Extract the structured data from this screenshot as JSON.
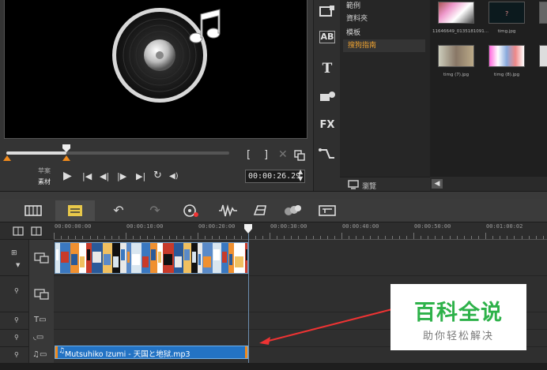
{
  "preview": {
    "scrub_progress": 0.27,
    "labels": {
      "project": "苹案",
      "clip": "素材"
    },
    "controls": {
      "play": "▶",
      "home": "|◀",
      "prev_frame": "◀|",
      "next_frame": "|▶",
      "end": "▶|",
      "repeat": "↻",
      "volume": "◀)"
    },
    "bracket_in": "[",
    "bracket_out": "]",
    "timecode": "00:00:26.29"
  },
  "tools": {
    "fx": "FX",
    "title": "T",
    "ab": "AB"
  },
  "library": {
    "items": [
      "範例",
      "資料夾",
      "模板",
      "搜狗指南"
    ],
    "active_index": 3,
    "footer_label": "瀏覽"
  },
  "thumbnails": [
    {
      "caption": "11646649_0135181091..."
    },
    {
      "caption": "timg.jpg"
    },
    {
      "caption": "timg (7).jpg"
    },
    {
      "caption": "timg (8).jpg"
    }
  ],
  "ruler": {
    "ticks": [
      "00:00:00:00",
      "00:00:10:00",
      "00:00:20:00",
      "00:00:30:00",
      "00:00:40:00",
      "00:00:50:00",
      "00:01:00:02"
    ]
  },
  "audio_clip": {
    "label": "Mutsuhiko Izumi - 天国と地狱.mp3"
  },
  "watermark": {
    "title": "百科全说",
    "subtitle": "助你轻松解决"
  },
  "colors": {
    "accent": "#f08a1c",
    "audio_clip": "#2373c4",
    "active_item": "#f0a330",
    "watermark_green": "#2eb24a"
  }
}
